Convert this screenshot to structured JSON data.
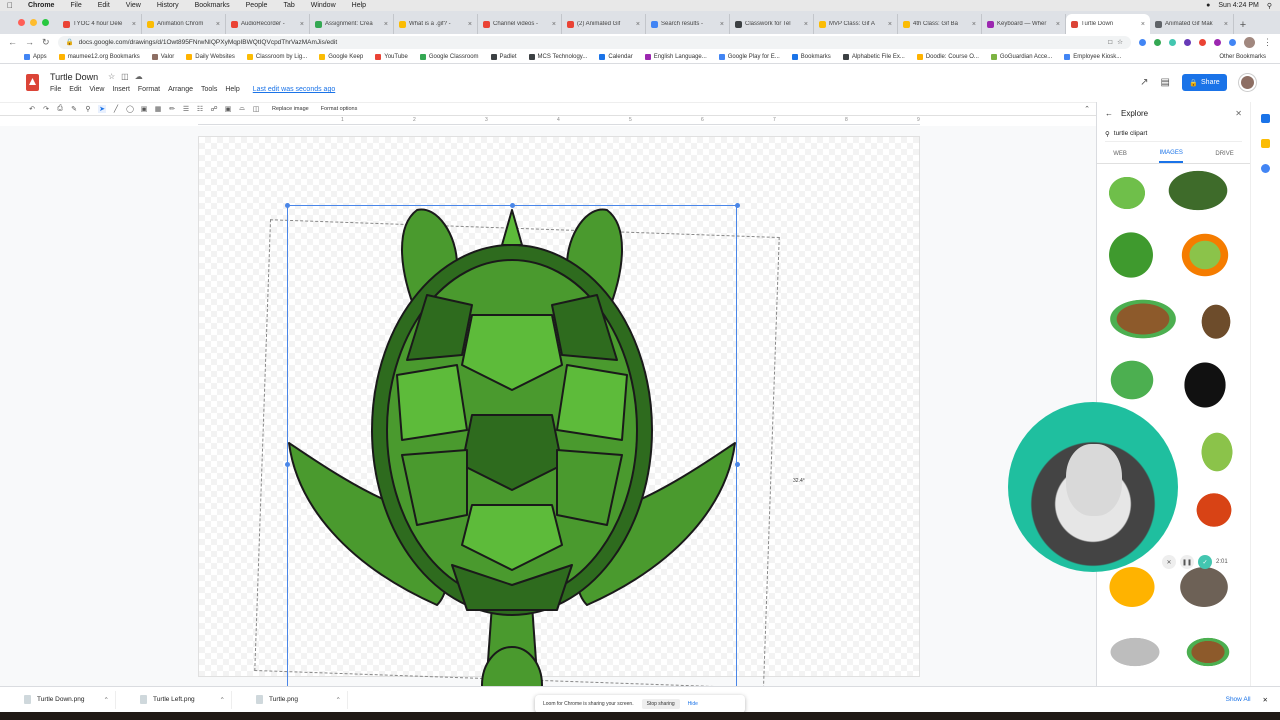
{
  "menubar": {
    "items": [
      "Chrome",
      "File",
      "Edit",
      "View",
      "History",
      "Bookmarks",
      "People",
      "Tab",
      "Window",
      "Help"
    ],
    "clock": "Sun 4:24 PM"
  },
  "tabs": [
    {
      "label": "TYOC 4 hour Dele",
      "color": "#ea4335"
    },
    {
      "label": "Animation Chrom",
      "color": "#fbbc04"
    },
    {
      "label": "AudioRecorder -",
      "color": "#ea4335"
    },
    {
      "label": "Assignment: Crea",
      "color": "#34a853"
    },
    {
      "label": "What is a .gif? -",
      "color": "#fbbc04"
    },
    {
      "label": "Channel videos -",
      "color": "#ea4335"
    },
    {
      "label": "(2) Animated Gif",
      "color": "#ea4335"
    },
    {
      "label": "Search results -",
      "color": "#4285f4"
    },
    {
      "label": "Classwork for Tel",
      "color": "#3c4043"
    },
    {
      "label": "MVP Class: Gif A",
      "color": "#fbbc04"
    },
    {
      "label": "4th Class: Gif Ba",
      "color": "#fbbc04"
    },
    {
      "label": "Keyboard — Wher",
      "color": "#9c27b0"
    },
    {
      "label": "Turtle Down",
      "color": "#db4437",
      "active": true
    },
    {
      "label": "Animated Gif Mak",
      "color": "#5f6368"
    }
  ],
  "address": {
    "url": "docs.google.com/drawings/d/1Owt895FNrwNIQPXyMqpIBWQtIQVcpdThrVazMAmJis/edit"
  },
  "bookmarks": [
    "Apps",
    "maumee12.org Bookmarks",
    "Valor",
    "Daily Websites",
    "Classroom by Lig...",
    "Google Keep",
    "YouTube",
    "Google Classroom",
    "Padlet",
    "MCS Technology...",
    "Calendar",
    "English Language...",
    "Google Play for E...",
    "Bookmarks",
    "Alphabetic File Ex...",
    "Doodle: Course O...",
    "GoGuardian Acce...",
    "Employee Kiosk..."
  ],
  "bookmarks_other": "Other Bookmarks",
  "doc": {
    "title": "Turtle Down",
    "menus": [
      "File",
      "Edit",
      "View",
      "Insert",
      "Format",
      "Arrange",
      "Tools",
      "Help"
    ],
    "last_edit": "Last edit was seconds ago",
    "share_label": "Share"
  },
  "toolbar": {
    "replace_image": "Replace image",
    "format_options": "Format options"
  },
  "ruler": [
    "1",
    "2",
    "3",
    "4",
    "5",
    "6",
    "7",
    "8",
    "9"
  ],
  "canvas": {
    "rotation_readout": "32.4°"
  },
  "explore": {
    "title": "Explore",
    "query": "turtle clipart",
    "tabs": [
      "WEB",
      "IMAGES",
      "DRIVE"
    ],
    "active_tab": "IMAGES"
  },
  "recorder": {
    "timer": "2:01"
  },
  "downloads": {
    "files": [
      "Turtle Down.png",
      "Turtle Left.png",
      "Turtle.png"
    ],
    "show_all": "Show All"
  },
  "share_bar": {
    "message": "Loom for Chrome is sharing your screen.",
    "stop": "Stop sharing",
    "hide": "Hide"
  },
  "colors": {
    "accent": "#1a73e8",
    "turtle_light": "#5dbb3a",
    "turtle_mid": "#4a9a2e",
    "turtle_dark": "#2e6b1e"
  }
}
